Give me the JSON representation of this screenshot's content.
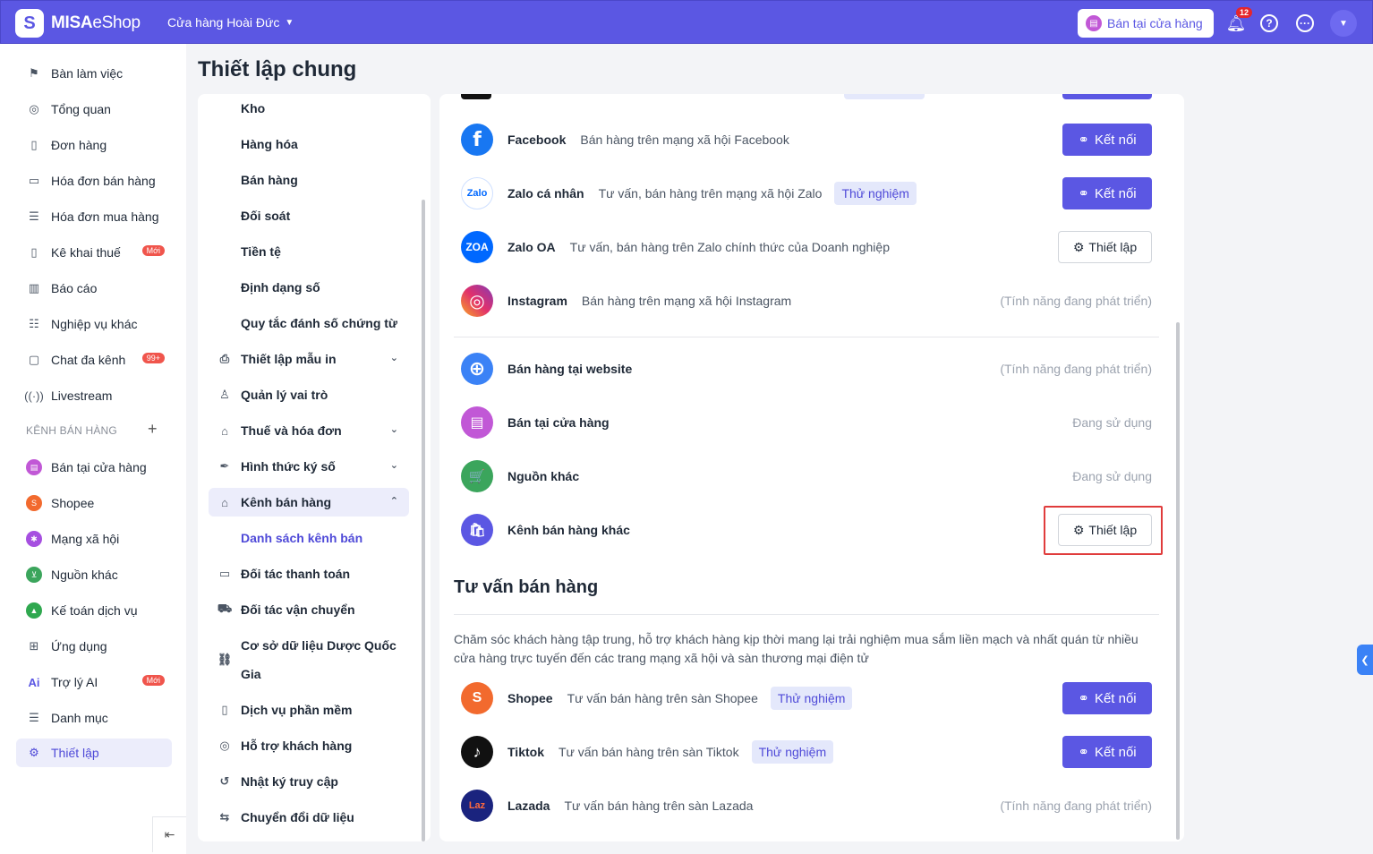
{
  "header": {
    "logo_mark": "S",
    "logo_bold": "MISA",
    "logo_light": "eShop",
    "store_name": "Cửa hàng Hoài Đức",
    "sell_button": "Bán tại cửa hàng",
    "notification_count": "12"
  },
  "sidebar": {
    "items": [
      {
        "label": "Bàn làm việc",
        "icon": "flag-icon"
      },
      {
        "label": "Tổng quan",
        "icon": "compass-icon"
      },
      {
        "label": "Đơn hàng",
        "icon": "order-icon"
      },
      {
        "label": "Hóa đơn bán hàng",
        "icon": "invoice-icon"
      },
      {
        "label": "Hóa đơn mua hàng",
        "icon": "receipt-icon"
      },
      {
        "label": "Kê khai thuế",
        "icon": "tax-icon",
        "tag": "Mới"
      },
      {
        "label": "Báo cáo",
        "icon": "report-icon"
      },
      {
        "label": "Nghiệp vụ khác",
        "icon": "list-icon"
      },
      {
        "label": "Chat đa kênh",
        "icon": "chat-icon",
        "tag": "99+"
      },
      {
        "label": "Livestream",
        "icon": "live-icon"
      }
    ],
    "section_label": "KÊNH BÁN HÀNG",
    "channels": [
      {
        "label": "Bán tại cửa hàng",
        "color": "#c158d6"
      },
      {
        "label": "Shopee",
        "color": "#f26a2e"
      },
      {
        "label": "Mạng xã hội",
        "color": "#a64fe0"
      },
      {
        "label": "Nguồn khác",
        "color": "#3ba55c"
      },
      {
        "label": "Kế toán dịch vụ",
        "color": "#2fa84f"
      }
    ],
    "bottom": [
      {
        "label": "Ứng dụng"
      },
      {
        "label": "Trợ lý AI",
        "tag": "Mới"
      },
      {
        "label": "Danh mục"
      },
      {
        "label": "Thiết lập"
      }
    ]
  },
  "page_title": "Thiết lập chung",
  "settings_menu": {
    "items": [
      {
        "label": "Kho"
      },
      {
        "label": "Hàng hóa"
      },
      {
        "label": "Bán hàng"
      },
      {
        "label": "Đối soát"
      },
      {
        "label": "Tiền tệ"
      },
      {
        "label": "Định dạng số"
      },
      {
        "label": "Quy tắc đánh số chứng từ"
      },
      {
        "label": "Thiết lập mẫu in"
      },
      {
        "label": "Quản lý vai trò"
      },
      {
        "label": "Thuế và hóa đơn"
      },
      {
        "label": "Hình thức ký số"
      },
      {
        "label": "Kênh bán hàng"
      },
      {
        "label": "Danh sách kênh bán"
      },
      {
        "label": "Đối tác thanh toán"
      },
      {
        "label": "Đối tác vận chuyển"
      },
      {
        "label": "Cơ sở dữ liệu Dược Quốc"
      },
      {
        "label": "Gia"
      },
      {
        "label": "Dịch vụ phần mềm"
      },
      {
        "label": "Hỗ trợ khách hàng"
      },
      {
        "label": "Nhật ký truy cập"
      },
      {
        "label": "Chuyển đổi dữ liệu"
      }
    ]
  },
  "channels_list": [
    {
      "name": "Facebook",
      "desc": "Bán hàng trên mạng xã hội Facebook",
      "action": "Kết nối",
      "logo": "f",
      "color": "#1877f2"
    },
    {
      "name": "Zalo cá nhân",
      "desc": "Tư vấn, bán hàng trên mạng xã hội Zalo",
      "pill": "Thử nghiệm",
      "action": "Kết nối",
      "logo": "Zalo",
      "color": "#ffffff"
    },
    {
      "name": "Zalo OA",
      "desc": "Tư vấn, bán hàng trên Zalo chính thức của Doanh nghiệp",
      "action": "Thiết lập",
      "logo": "ZOA",
      "color": "#0068ff"
    },
    {
      "name": "Instagram",
      "desc": "Bán hàng trên mạng xã hội Instagram",
      "status": "(Tính năng đang phát triển)",
      "logo": "◎",
      "color": "#e1306c"
    },
    {
      "name": "Bán hàng tại website",
      "status": "(Tính năng đang phát triển)",
      "logo": "⊕",
      "color": "#3b82f6"
    },
    {
      "name": "Bán tại cửa hàng",
      "status": "Đang sử dụng",
      "logo": "▤",
      "color": "#c158d6"
    },
    {
      "name": "Nguồn khác",
      "status": "Đang sử dụng",
      "logo": "🛒",
      "color": "#3ba55c"
    },
    {
      "name": "Kênh bán hàng khác",
      "action": "Thiết lập",
      "logo": "🛍",
      "color": "#5b57e3"
    }
  ],
  "consult": {
    "title": "Tư vấn bán hàng",
    "description": "Chăm sóc khách hàng tập trung, hỗ trợ khách hàng kịp thời mang lại trải nghiệm mua sắm liền mạch và nhất quán từ nhiều cửa hàng trực tuyến đến các trang mạng xã hội và sàn thương mại điện tử",
    "items": [
      {
        "name": "Shopee",
        "desc": "Tư vấn bán hàng trên sàn Shopee",
        "pill": "Thử nghiệm",
        "action": "Kết nối",
        "logo": "S",
        "color": "#f26a2e"
      },
      {
        "name": "Tiktok",
        "desc": "Tư vấn bán hàng trên sàn Tiktok",
        "pill": "Thử nghiệm",
        "action": "Kết nối",
        "logo": "♪",
        "color": "#111111"
      },
      {
        "name": "Lazada",
        "desc": "Tư vấn bán hàng trên sàn Lazada",
        "status": "(Tính năng đang phát triển)",
        "logo": "Laz",
        "color": "#1a237e"
      }
    ]
  }
}
